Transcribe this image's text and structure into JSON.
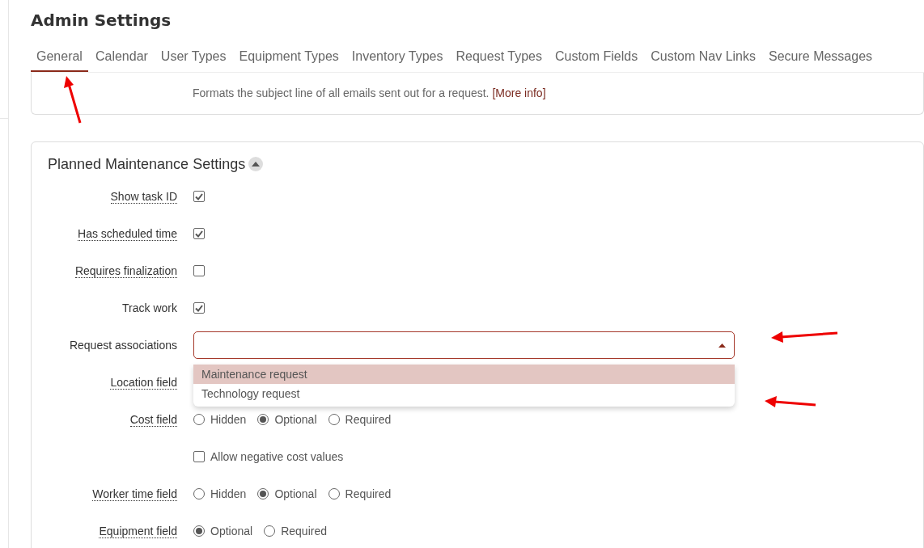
{
  "page": {
    "title": "Admin Settings"
  },
  "tabs": [
    {
      "label": "General",
      "selected": true
    },
    {
      "label": "Calendar",
      "selected": false
    },
    {
      "label": "User Types",
      "selected": false
    },
    {
      "label": "Equipment Types",
      "selected": false
    },
    {
      "label": "Inventory Types",
      "selected": false
    },
    {
      "label": "Request Types",
      "selected": false
    },
    {
      "label": "Custom Fields",
      "selected": false
    },
    {
      "label": "Custom Nav Links",
      "selected": false
    },
    {
      "label": "Secure Messages",
      "selected": false
    }
  ],
  "subject_card": {
    "description": "Formats the subject line of all emails sent out for a request.",
    "link": "[More info]"
  },
  "section": {
    "title": "Planned Maintenance Settings",
    "expanded": true,
    "rows": [
      {
        "kind": "checkbox",
        "label": "Show task ID",
        "has_help": true,
        "checked": true
      },
      {
        "kind": "checkbox",
        "label": "Has scheduled time",
        "has_help": true,
        "checked": true
      },
      {
        "kind": "checkbox",
        "label": "Requires finalization",
        "has_help": true,
        "checked": false
      },
      {
        "kind": "checkbox",
        "label": "Track work",
        "has_help": false,
        "checked": true
      },
      {
        "kind": "select",
        "label": "Request associations",
        "has_help": false,
        "open": true,
        "options": [
          {
            "label": "Maintenance request",
            "highlighted": true
          },
          {
            "label": "Technology request",
            "highlighted": false
          }
        ]
      },
      {
        "kind": "covered",
        "label": "Location field",
        "has_help": true
      },
      {
        "kind": "radio",
        "label": "Cost field",
        "has_help": true,
        "options": [
          {
            "label": "Hidden",
            "selected": false
          },
          {
            "label": "Optional",
            "selected": true
          },
          {
            "label": "Required",
            "selected": false
          }
        ]
      },
      {
        "kind": "checkbox_option",
        "option": "Allow negative cost values",
        "checked": false
      },
      {
        "kind": "radio",
        "label": "Worker time field",
        "has_help": true,
        "options": [
          {
            "label": "Hidden",
            "selected": false
          },
          {
            "label": "Optional",
            "selected": true
          },
          {
            "label": "Required",
            "selected": false
          }
        ]
      },
      {
        "kind": "radio",
        "label": "Equipment field",
        "has_help": true,
        "options": [
          {
            "label": "Optional",
            "selected": true
          },
          {
            "label": "Required",
            "selected": false
          }
        ]
      }
    ]
  }
}
